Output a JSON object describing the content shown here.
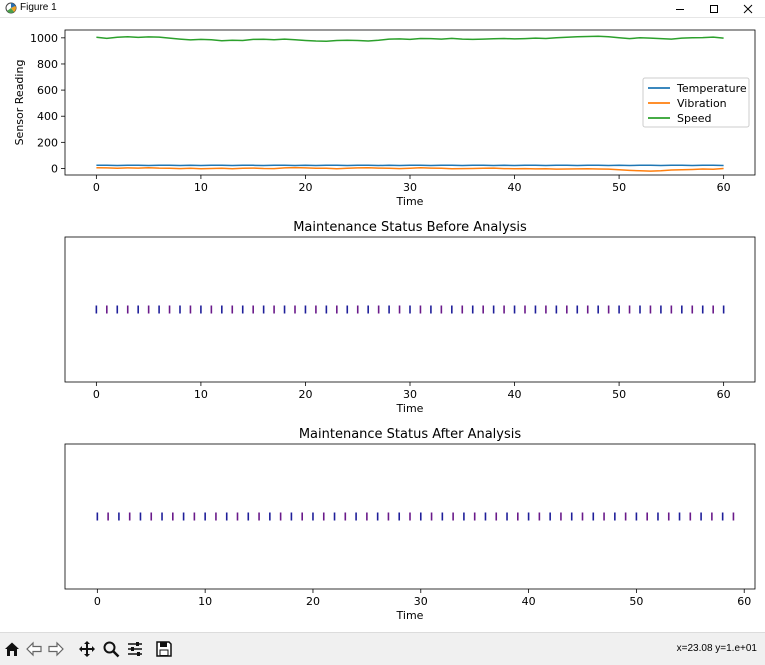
{
  "window": {
    "title": "Figure 1",
    "buttons": [
      {
        "name": "minimize-button",
        "icon": "minimize-icon"
      },
      {
        "name": "maximize-button",
        "icon": "maximize-icon"
      },
      {
        "name": "close-button",
        "icon": "close-icon"
      }
    ]
  },
  "toolbar": {
    "buttons": [
      {
        "name": "home-button",
        "icon": "home-icon"
      },
      {
        "name": "back-button",
        "icon": "back-arrow-icon"
      },
      {
        "name": "forward-button",
        "icon": "forward-arrow-icon"
      },
      {
        "name": "pan-button",
        "icon": "pan-move-icon"
      },
      {
        "name": "zoom-button",
        "icon": "zoom-magnifier-icon"
      },
      {
        "name": "configure-subplots-button",
        "icon": "sliders-icon"
      },
      {
        "name": "save-button",
        "icon": "save-floppy-icon"
      }
    ],
    "coords": "x=23.08 y=1.e+01"
  },
  "chart_data": [
    {
      "type": "line",
      "title": "",
      "xlabel": "Time",
      "ylabel": "Sensor Reading",
      "xlim": [
        -3,
        63
      ],
      "ylim": [
        -50,
        1060
      ],
      "xticks": [
        0,
        10,
        20,
        30,
        40,
        50,
        60
      ],
      "yticks": [
        0,
        200,
        400,
        600,
        800,
        1000
      ],
      "legend": "right",
      "x": [
        0,
        1,
        2,
        3,
        4,
        5,
        6,
        7,
        8,
        9,
        10,
        11,
        12,
        13,
        14,
        15,
        16,
        17,
        18,
        19,
        20,
        21,
        22,
        23,
        24,
        25,
        26,
        27,
        28,
        29,
        30,
        31,
        32,
        33,
        34,
        35,
        36,
        37,
        38,
        39,
        40,
        41,
        42,
        43,
        44,
        45,
        46,
        47,
        48,
        49,
        50,
        51,
        52,
        53,
        54,
        55,
        56,
        57,
        58,
        59,
        60
      ],
      "series": [
        {
          "name": "Temperature",
          "color": "#1f77b4",
          "values": [
            24,
            24,
            23,
            24,
            24,
            23,
            24,
            24,
            23,
            24,
            23,
            24,
            24,
            23,
            24,
            24,
            23,
            24,
            24,
            23,
            24,
            23,
            24,
            24,
            23,
            24,
            24,
            23,
            24,
            23,
            24,
            24,
            23,
            24,
            24,
            23,
            24,
            24,
            23,
            24,
            23,
            24,
            24,
            23,
            24,
            24,
            23,
            24,
            24,
            23,
            24,
            23,
            24,
            24,
            23,
            24,
            24,
            23,
            24,
            24,
            23
          ]
        },
        {
          "name": "Vibration",
          "color": "#ff7f0e",
          "values": [
            5,
            4,
            2,
            4,
            3,
            6,
            3,
            2,
            -1,
            1,
            -2,
            0,
            2,
            -2,
            1,
            3,
            0,
            -1,
            4,
            7,
            4,
            1,
            2,
            -2,
            1,
            4,
            6,
            3,
            1,
            -1,
            2,
            5,
            3,
            1,
            -2,
            -1,
            0,
            1,
            3,
            -1,
            -2,
            -1,
            -3,
            -2,
            -5,
            -4,
            -3,
            -2,
            -4,
            -5,
            -10,
            -15,
            -18,
            -20,
            -18,
            -12,
            -10,
            -8,
            -4,
            -6,
            0
          ]
        },
        {
          "name": "Speed",
          "color": "#2ca02c",
          "values": [
            1005,
            996,
            1004,
            1008,
            1003,
            1007,
            1006,
            998,
            990,
            984,
            988,
            985,
            978,
            982,
            980,
            988,
            989,
            986,
            990,
            985,
            980,
            976,
            974,
            980,
            982,
            980,
            976,
            982,
            990,
            992,
            988,
            995,
            994,
            990,
            996,
            990,
            988,
            990,
            993,
            995,
            992,
            994,
            998,
            995,
            1000,
            1004,
            1008,
            1010,
            1012,
            1008,
            1000,
            994,
            1000,
            998,
            994,
            990,
            998,
            1000,
            1002,
            1006,
            998
          ]
        }
      ]
    },
    {
      "type": "scatter",
      "title": "Maintenance Status Before Analysis",
      "xlabel": "Time",
      "ylabel": "",
      "xlim": [
        -3,
        63
      ],
      "xticks": [
        0,
        10,
        20,
        30,
        40,
        50,
        60
      ],
      "marker": "|",
      "colors": [
        "#1f1f9a",
        "#6a1a8a"
      ],
      "x": [
        0,
        1,
        2,
        3,
        4,
        5,
        6,
        7,
        8,
        9,
        10,
        11,
        12,
        13,
        14,
        15,
        16,
        17,
        18,
        19,
        20,
        21,
        22,
        23,
        24,
        25,
        26,
        27,
        28,
        29,
        30,
        31,
        32,
        33,
        34,
        35,
        36,
        37,
        38,
        39,
        40,
        41,
        42,
        43,
        44,
        45,
        46,
        47,
        48,
        49,
        50,
        51,
        52,
        53,
        54,
        55,
        56,
        57,
        58,
        59,
        60
      ]
    },
    {
      "type": "scatter",
      "title": "Maintenance Status After Analysis",
      "xlabel": "Time",
      "ylabel": "",
      "xlim": [
        -3,
        61
      ],
      "xticks": [
        0,
        10,
        20,
        30,
        40,
        50,
        60
      ],
      "marker": "|",
      "colors": [
        "#1f1f9a",
        "#6a1a8a"
      ],
      "x": [
        0,
        1,
        2,
        3,
        4,
        5,
        6,
        7,
        8,
        9,
        10,
        11,
        12,
        13,
        14,
        15,
        16,
        17,
        18,
        19,
        20,
        21,
        22,
        23,
        24,
        25,
        26,
        27,
        28,
        29,
        30,
        31,
        32,
        33,
        34,
        35,
        36,
        37,
        38,
        39,
        40,
        41,
        42,
        43,
        44,
        45,
        46,
        47,
        48,
        49,
        50,
        51,
        52,
        53,
        54,
        55,
        56,
        57,
        58,
        59
      ]
    }
  ]
}
